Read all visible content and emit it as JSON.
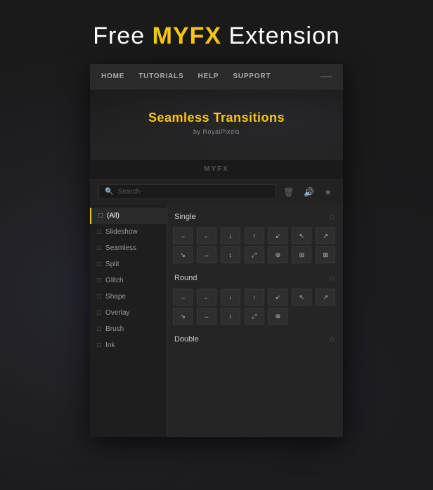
{
  "header": {
    "title_prefix": "Free ",
    "brand": "MYFX",
    "title_suffix": " Extension"
  },
  "nav": {
    "items": [
      "HOME",
      "TUTORIALS",
      "HELP",
      "SUPPORT"
    ],
    "dash": "—"
  },
  "hero": {
    "title": "Seamless Transitions",
    "subtitle": "by RoyalPixels"
  },
  "myfx_label": "MYFX",
  "toolbar": {
    "search_placeholder": "Search",
    "delete_icon": "🗑",
    "audio_icon": "🔊",
    "star_icon": "★"
  },
  "sidebar": {
    "items": [
      {
        "id": "all",
        "label": "(All)",
        "active": true,
        "icon": "□"
      },
      {
        "id": "slideshow",
        "label": "Slideshow",
        "active": false,
        "icon": "□"
      },
      {
        "id": "seamless",
        "label": "Seamless",
        "active": false,
        "icon": "□"
      },
      {
        "id": "split",
        "label": "Split",
        "active": false,
        "icon": "□"
      },
      {
        "id": "glitch",
        "label": "Glitch",
        "active": false,
        "icon": "□"
      },
      {
        "id": "shape",
        "label": "Shape",
        "active": false,
        "icon": "□"
      },
      {
        "id": "overlay",
        "label": "Overlay",
        "active": false,
        "icon": "□"
      },
      {
        "id": "brush",
        "label": "Brush",
        "active": false,
        "icon": "□"
      },
      {
        "id": "ink",
        "label": "Ink",
        "active": false,
        "icon": "□"
      }
    ]
  },
  "sections": [
    {
      "id": "single",
      "title": "Single",
      "rows": [
        [
          "→",
          "←",
          "↓",
          "↑",
          "↙",
          "↖",
          "↗"
        ],
        [
          "↘",
          "↔",
          "↕",
          "⤢",
          "⊕",
          "⊞",
          "⊠"
        ]
      ]
    },
    {
      "id": "round",
      "title": "Round",
      "rows": [
        [
          "→",
          "←",
          "↓",
          "↑",
          "↙",
          "↖",
          "↗"
        ],
        [
          "↘",
          "↔",
          "↕",
          "⤢",
          "⊕",
          "",
          ""
        ]
      ]
    },
    {
      "id": "double",
      "title": "Double",
      "rows": []
    }
  ],
  "colors": {
    "accent": "#f5c518",
    "bg_dark": "#1a1a1a",
    "bg_panel": "#222222",
    "text_primary": "#ffffff",
    "text_secondary": "#aaaaaa"
  }
}
